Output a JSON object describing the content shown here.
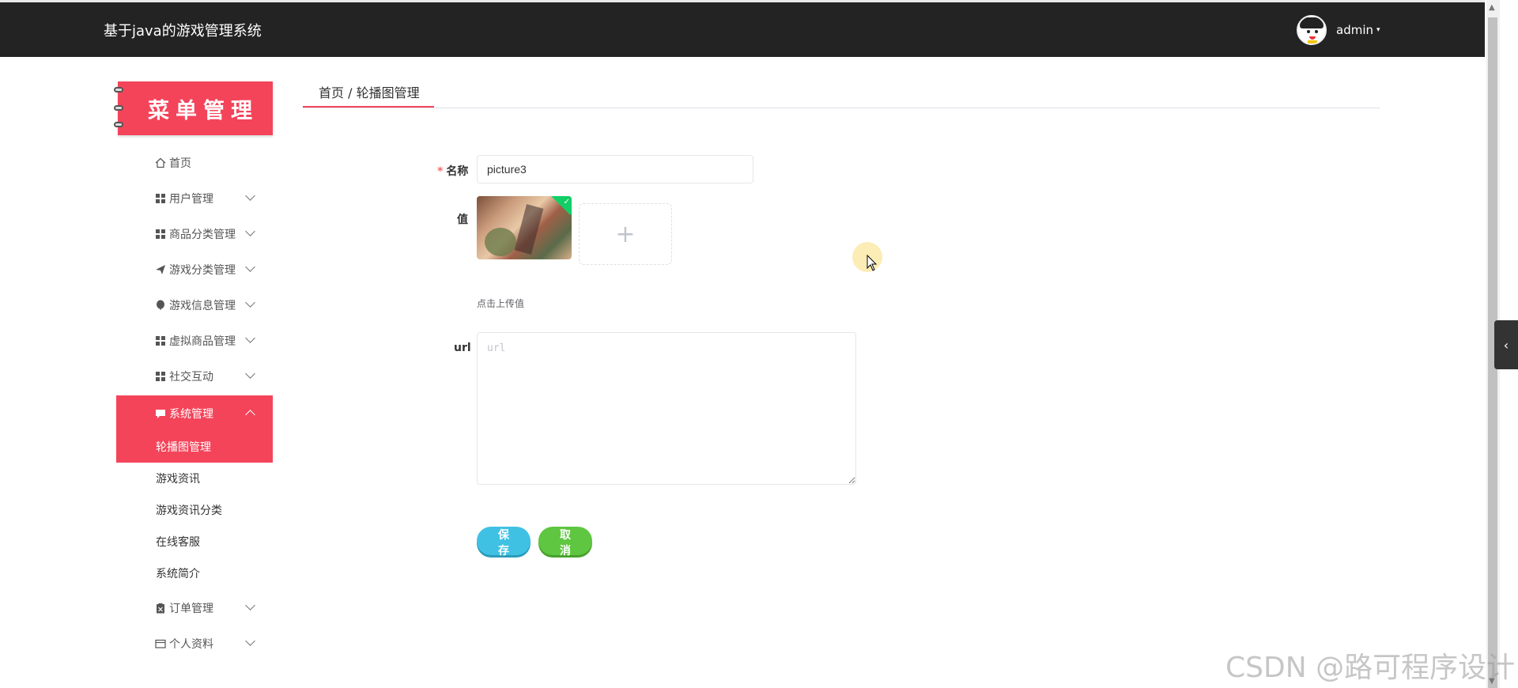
{
  "header": {
    "app_title": "基于java的游戏管理系统",
    "user_name": "admin",
    "caret": "▾"
  },
  "sidebar": {
    "banner": "菜单管理",
    "items": [
      {
        "label": "首页",
        "icon": "home-icon"
      },
      {
        "label": "用户管理",
        "icon": "grid-icon"
      },
      {
        "label": "商品分类管理",
        "icon": "grid-icon"
      },
      {
        "label": "游戏分类管理",
        "icon": "paper-plane-icon"
      },
      {
        "label": "游戏信息管理",
        "icon": "balloon-icon"
      },
      {
        "label": "虚拟商品管理",
        "icon": "grid-icon"
      },
      {
        "label": "社交互动",
        "icon": "grid-icon"
      },
      {
        "label": "系统管理",
        "icon": "chat-icon",
        "expanded": true
      },
      {
        "label": "订单管理",
        "icon": "clipboard-icon"
      },
      {
        "label": "个人资料",
        "icon": "card-icon"
      }
    ],
    "sub_items": [
      {
        "label": "轮播图管理",
        "active": true
      },
      {
        "label": "游戏资讯"
      },
      {
        "label": "游戏资讯分类"
      },
      {
        "label": "在线客服"
      },
      {
        "label": "系统简介"
      }
    ]
  },
  "breadcrumb": {
    "text": "首页 / 轮播图管理"
  },
  "form": {
    "name_label": "名称",
    "name_value": "picture3",
    "value_label": "值",
    "upload_plus": "+",
    "upload_tip": "点击上传值",
    "url_label": "url",
    "url_placeholder": "url",
    "save_label": "保存",
    "cancel_label": "取消"
  },
  "watermark": "CSDN @路可程序设计",
  "colors": {
    "accent": "#f4445a",
    "header_bg": "#232323",
    "save_button": "#3fc1e3",
    "cancel_button": "#5ec640"
  }
}
